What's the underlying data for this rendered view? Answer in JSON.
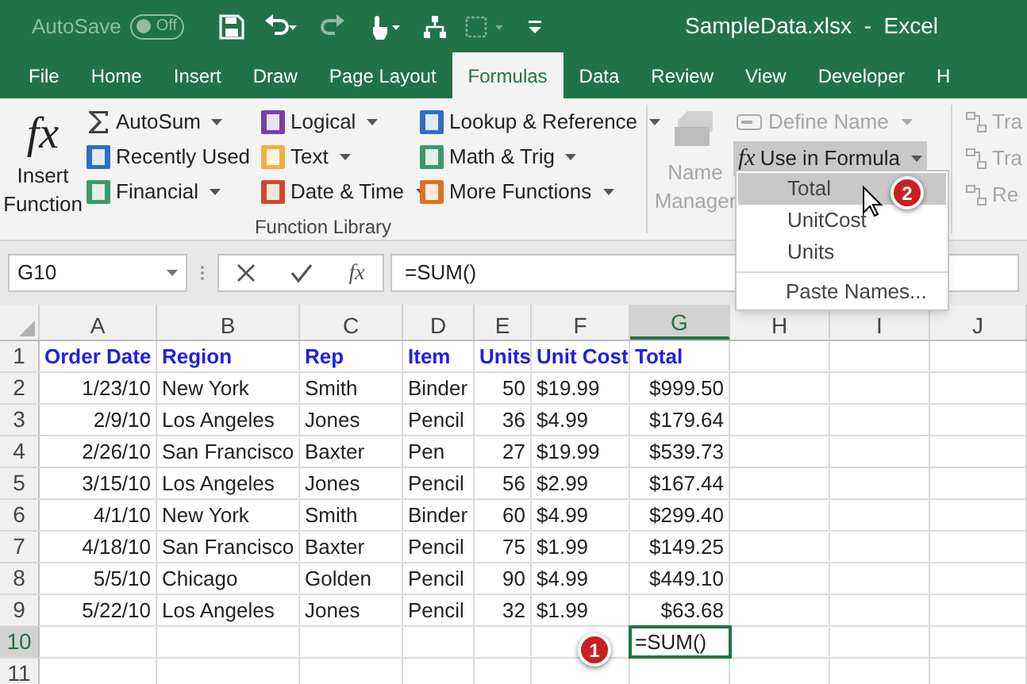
{
  "title_bar": {
    "autosave_label": "AutoSave",
    "autosave_state": "Off",
    "autosave_on": false,
    "title": "SampleData.xlsx  -  Excel"
  },
  "tabs": [
    {
      "label": "File",
      "selected": false
    },
    {
      "label": "Home",
      "selected": false
    },
    {
      "label": "Insert",
      "selected": false
    },
    {
      "label": "Draw",
      "selected": false
    },
    {
      "label": "Page Layout",
      "selected": false
    },
    {
      "label": "Formulas",
      "selected": true
    },
    {
      "label": "Data",
      "selected": false
    },
    {
      "label": "Review",
      "selected": false
    },
    {
      "label": "View",
      "selected": false
    },
    {
      "label": "Developer",
      "selected": false
    },
    {
      "label": "H",
      "selected": false
    }
  ],
  "ribbon": {
    "insert_function_icon": "fx",
    "insert_function": [
      "Insert",
      "Function"
    ],
    "function_columns": [
      [
        {
          "label": "AutoSum",
          "kind": "sigma",
          "color": "#404040"
        },
        {
          "label": "Recently Used",
          "kind": "square",
          "color": "#2e6fc0"
        },
        {
          "label": "Financial",
          "kind": "square",
          "color": "#3a9a6a"
        }
      ],
      [
        {
          "label": "Logical",
          "kind": "square",
          "color": "#7a3fa8"
        },
        {
          "label": "Text",
          "kind": "square",
          "color": "#f0b040"
        },
        {
          "label": "Date & Time",
          "kind": "square",
          "color": "#d04a2a"
        }
      ],
      [
        {
          "label": "Lookup & Reference",
          "kind": "square",
          "color": "#2e6fc0"
        },
        {
          "label": "Math & Trig",
          "kind": "square",
          "color": "#3a9a6a"
        },
        {
          "label": "More Functions",
          "kind": "square",
          "color": "#e07020"
        }
      ]
    ],
    "group_label": "Function Library",
    "name_manager": {
      "label": [
        "Name",
        "Manager"
      ],
      "disabled": true
    },
    "define_name": {
      "label": "Define Name",
      "disabled": true
    },
    "use_in_formula": {
      "icon": "fx",
      "label": "Use in Formula",
      "pressed": true
    },
    "auditing": [
      "Tra",
      "Tra",
      "Re"
    ]
  },
  "dropdown": {
    "items": [
      {
        "label": "Total",
        "selected": true
      },
      {
        "label": "UnitCost",
        "selected": false
      },
      {
        "label": "Units",
        "selected": false
      }
    ],
    "paste_names": "Paste Names..."
  },
  "formula_bar": {
    "name_box": "G10",
    "fx": "fx",
    "formula": "=SUM()"
  },
  "sheet": {
    "columns": [
      {
        "label": "A",
        "selected": false
      },
      {
        "label": "B",
        "selected": false
      },
      {
        "label": "C",
        "selected": false
      },
      {
        "label": "D",
        "selected": false
      },
      {
        "label": "E",
        "selected": false
      },
      {
        "label": "F",
        "selected": false
      },
      {
        "label": "G",
        "selected": true
      },
      {
        "label": "H",
        "selected": false
      },
      {
        "label": "I",
        "selected": false
      },
      {
        "label": "J",
        "selected": false
      }
    ],
    "rows": [
      {
        "number": "1",
        "kind": "header",
        "cells": [
          "Order Date",
          "Region",
          "Rep",
          "Item",
          "Units",
          "Unit Cost",
          "Total"
        ]
      },
      {
        "number": "2",
        "kind": "data",
        "cells": [
          "1/23/10",
          "New York",
          "Smith",
          "Binder",
          "50",
          "$19.99",
          "$999.50"
        ]
      },
      {
        "number": "3",
        "kind": "data",
        "cells": [
          "2/9/10",
          "Los Angeles",
          "Jones",
          "Pencil",
          "36",
          "$4.99",
          "$179.64"
        ]
      },
      {
        "number": "4",
        "kind": "data",
        "cells": [
          "2/26/10",
          "San Francisco",
          "Baxter",
          "Pen",
          "27",
          "$19.99",
          "$539.73"
        ]
      },
      {
        "number": "5",
        "kind": "data",
        "cells": [
          "3/15/10",
          "Los Angeles",
          "Jones",
          "Pencil",
          "56",
          "$2.99",
          "$167.44"
        ]
      },
      {
        "number": "6",
        "kind": "data",
        "cells": [
          "4/1/10",
          "New York",
          "Smith",
          "Binder",
          "60",
          "$4.99",
          "$299.40"
        ]
      },
      {
        "number": "7",
        "kind": "data",
        "cells": [
          "4/18/10",
          "San Francisco",
          "Baxter",
          "Pencil",
          "75",
          "$1.99",
          "$149.25"
        ]
      },
      {
        "number": "8",
        "kind": "data",
        "cells": [
          "5/5/10",
          "Chicago",
          "Golden",
          "Pencil",
          "90",
          "$4.99",
          "$449.10"
        ]
      },
      {
        "number": "9",
        "kind": "data",
        "cells": [
          "5/22/10",
          "Los Angeles",
          "Jones",
          "Pencil",
          "32",
          "$1.99",
          "$63.68"
        ]
      },
      {
        "number": "10",
        "kind": "entry",
        "entry": "=SUM()"
      },
      {
        "number": "11",
        "kind": "empty"
      }
    ]
  },
  "callouts": [
    "1",
    "2"
  ]
}
